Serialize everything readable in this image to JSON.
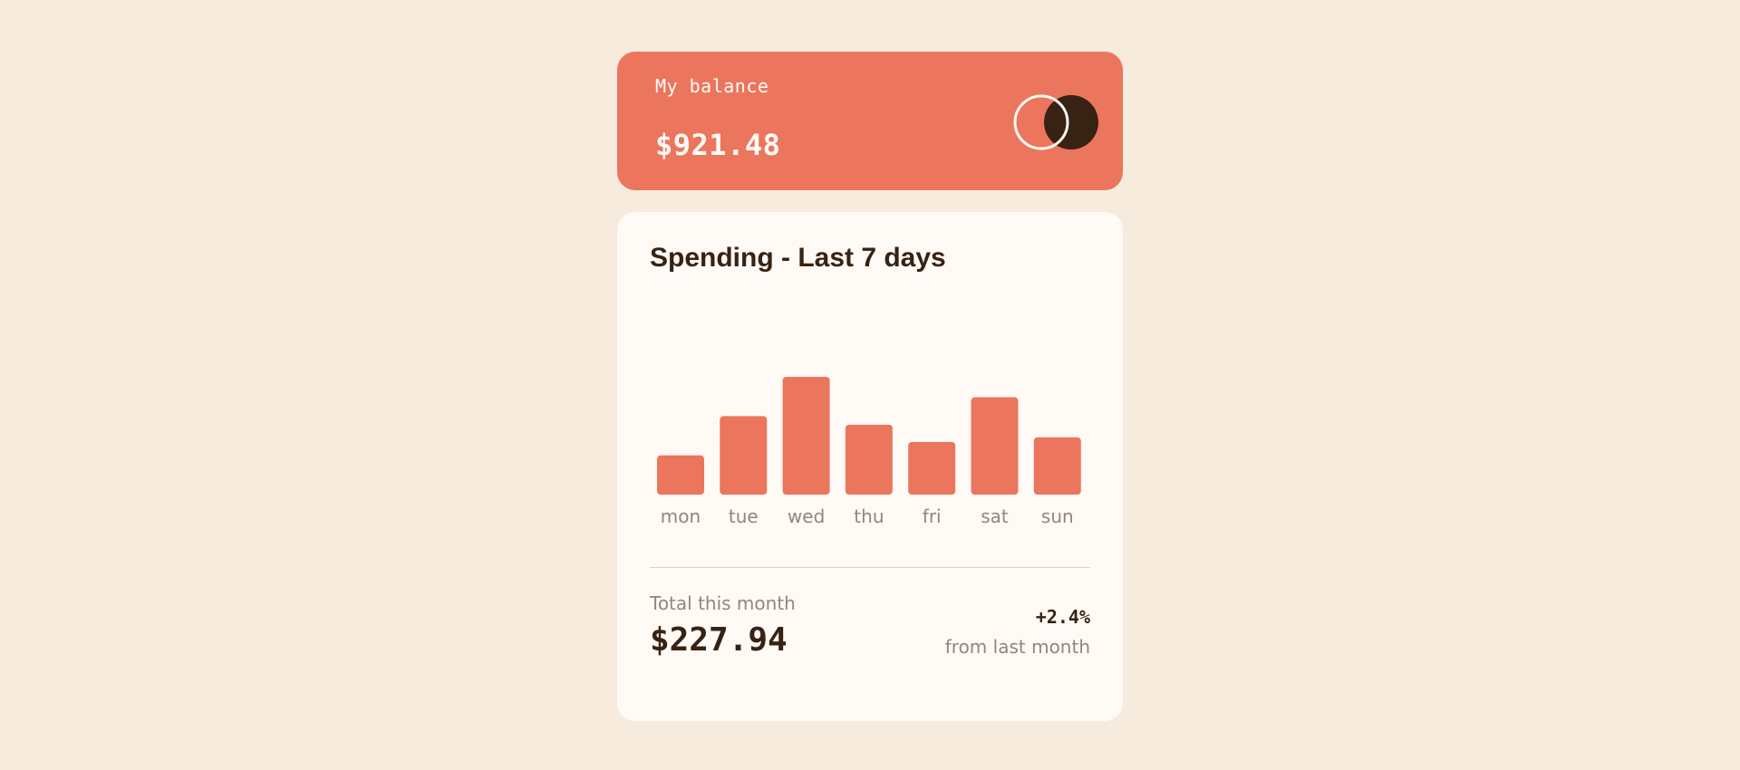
{
  "balance": {
    "label": "My balance",
    "value": "$921.48"
  },
  "logo": {
    "icon": "two-circles-logo-icon"
  },
  "spending": {
    "title": "Spending - Last 7 days",
    "total_label": "Total this month",
    "total_value": "$227.94",
    "change_value": "+2.4%",
    "change_label": "from last month"
  },
  "colors": {
    "background": "#f6ebdc",
    "accent": "#ec755d",
    "card": "#fffaf5",
    "dark": "#382213",
    "muted": "#93867b"
  },
  "chart_data": {
    "type": "bar",
    "categories": [
      "mon",
      "tue",
      "wed",
      "thu",
      "fri",
      "sat",
      "sun"
    ],
    "values": [
      17.45,
      34.91,
      52.36,
      31.07,
      23.39,
      43.28,
      25.48
    ],
    "grid": false
  }
}
